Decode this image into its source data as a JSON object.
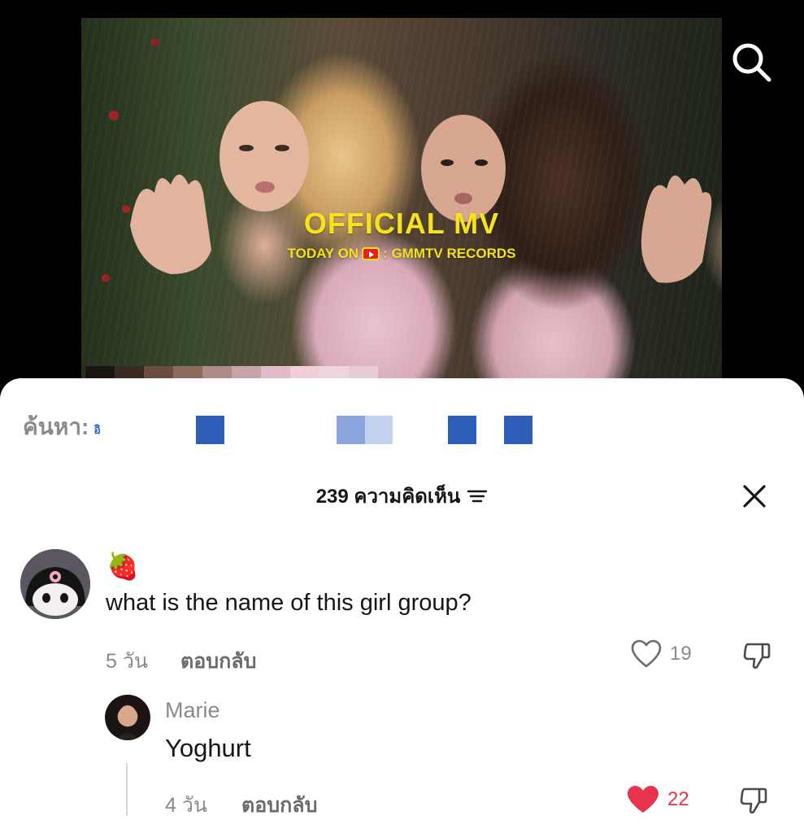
{
  "video": {
    "title": "OFFICIAL MV",
    "subtitle_prefix": "TODAY ON",
    "subtitle_channel": ": GMMTV RECORDS",
    "search_icon": "search-icon"
  },
  "search_suggestion": {
    "prefix": "ค้นหา:",
    "text": "อิ"
  },
  "comments_header": {
    "count_label": "239 ความคิดเห็น",
    "filter_icon": "filter-icon",
    "close_icon": "close-icon"
  },
  "comments": [
    {
      "username": "🍓",
      "text": "what is the name of this girl group?",
      "time": "5 วัน",
      "reply_label": "ตอบกลับ",
      "likes": "19",
      "liked": false,
      "replies": [
        {
          "username": "Marie",
          "text": "Yoghurt",
          "time": "4 วัน",
          "reply_label": "ตอบกลับ",
          "likes": "22",
          "liked": true
        }
      ]
    }
  ],
  "colors": {
    "liked": "#e8334f",
    "text": "#161616",
    "muted": "#8a8a8a",
    "mv_yellow": "#f6e21a",
    "censor_blue": "#2d5fb8"
  }
}
